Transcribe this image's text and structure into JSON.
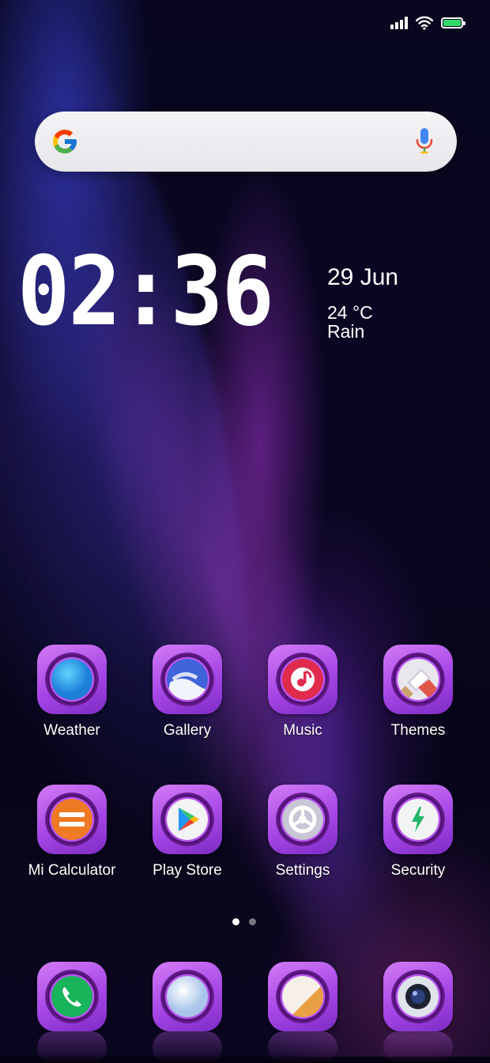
{
  "status_bar": {
    "icons": [
      "signal-icon",
      "wifi-icon",
      "battery-icon"
    ],
    "battery_level": 1.0,
    "battery_color": "#32d96a"
  },
  "search": {
    "logo": "google-g-icon",
    "mic": "mic-icon"
  },
  "clock_widget": {
    "time": "02:36",
    "date": "29 Jun",
    "temperature": "24 °C",
    "condition": "Rain"
  },
  "apps_row1": [
    {
      "label": "Weather",
      "icon": "weather-icon"
    },
    {
      "label": "Gallery",
      "icon": "gallery-icon"
    },
    {
      "label": "Music",
      "icon": "music-icon"
    },
    {
      "label": "Themes",
      "icon": "themes-icon"
    }
  ],
  "apps_row2": [
    {
      "label": "Mi Calculator",
      "icon": "calculator-icon"
    },
    {
      "label": "Play Store",
      "icon": "play-store-icon"
    },
    {
      "label": "Settings",
      "icon": "settings-icon"
    },
    {
      "label": "Security",
      "icon": "security-icon"
    }
  ],
  "pager": {
    "pages": 2,
    "current": 1
  },
  "dock": [
    {
      "icon": "phone-icon"
    },
    {
      "icon": "messages-icon"
    },
    {
      "icon": "browser-icon"
    },
    {
      "icon": "camera-icon"
    }
  ],
  "accent_color": "#b24ff0"
}
